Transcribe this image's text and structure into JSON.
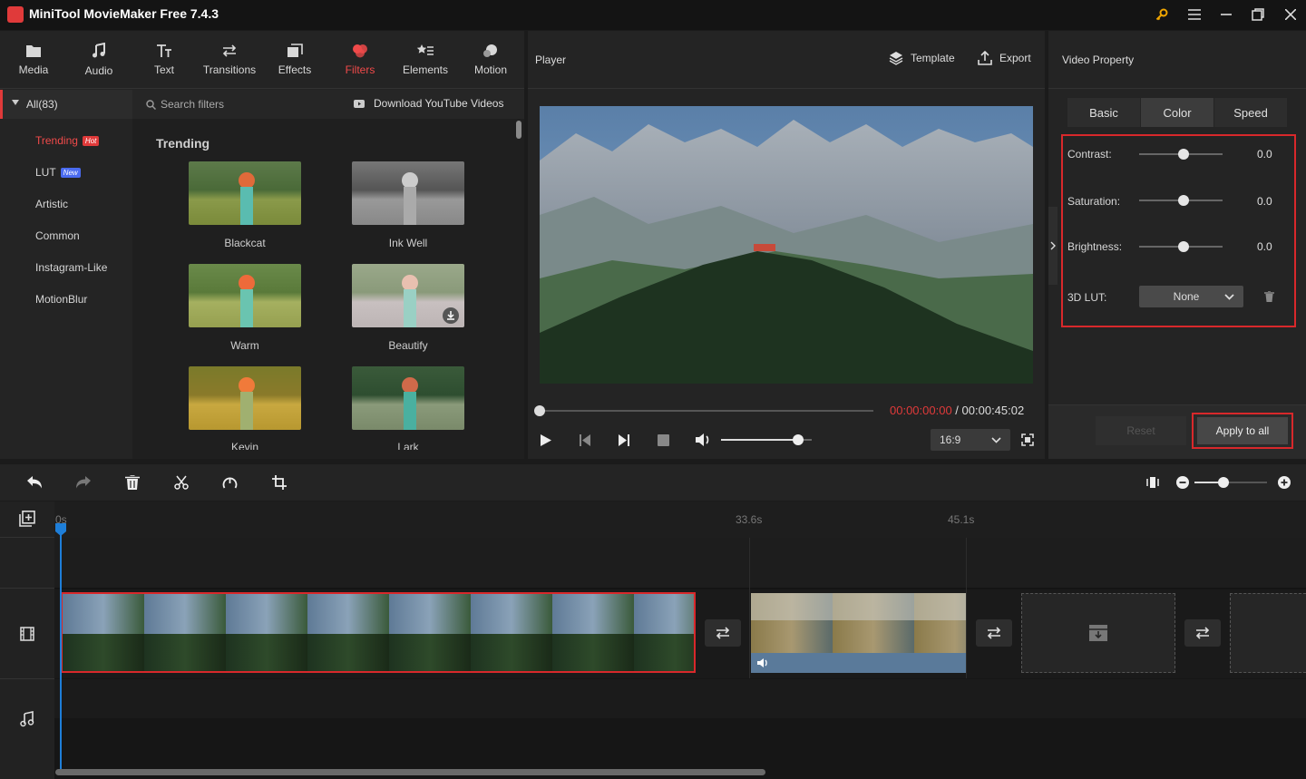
{
  "app": {
    "title": "MiniTool MovieMaker Free 7.4.3"
  },
  "toolbar": {
    "items": [
      {
        "label": "Media",
        "icon": "folder-icon"
      },
      {
        "label": "Audio",
        "icon": "music-note-icon"
      },
      {
        "label": "Text",
        "icon": "text-icon"
      },
      {
        "label": "Transitions",
        "icon": "transition-arrows-icon"
      },
      {
        "label": "Effects",
        "icon": "effects-icon"
      },
      {
        "label": "Filters",
        "icon": "filters-icon",
        "active": true
      },
      {
        "label": "Elements",
        "icon": "elements-icon"
      },
      {
        "label": "Motion",
        "icon": "motion-icon"
      }
    ]
  },
  "sidebar": {
    "all_label": "All(83)",
    "categories": [
      {
        "label": "Trending",
        "badge": "Hot"
      },
      {
        "label": "LUT",
        "badge": "New"
      },
      {
        "label": "Artistic"
      },
      {
        "label": "Common"
      },
      {
        "label": "Instagram-Like"
      },
      {
        "label": "MotionBlur"
      }
    ]
  },
  "filters": {
    "search_placeholder": "Search filters",
    "download_label": "Download YouTube Videos",
    "section_title": "Trending",
    "items": [
      {
        "label": "Blackcat"
      },
      {
        "label": "Ink Well"
      },
      {
        "label": "Warm"
      },
      {
        "label": "Beautify"
      },
      {
        "label": "Kevin"
      },
      {
        "label": "Lark"
      }
    ]
  },
  "player": {
    "title": "Player",
    "template_label": "Template",
    "export_label": "Export",
    "current_time": "00:00:00:00",
    "separator": " / ",
    "total_time": "00:00:45:02",
    "aspect_ratio": "16:9",
    "volume_level": 0.85
  },
  "property": {
    "title": "Video Property",
    "tabs": [
      "Basic",
      "Color",
      "Speed"
    ],
    "active_tab": "Color",
    "contrast_label": "Contrast:",
    "contrast_value": "0.0",
    "saturation_label": "Saturation:",
    "saturation_value": "0.0",
    "brightness_label": "Brightness:",
    "brightness_value": "0.0",
    "lut_label": "3D LUT:",
    "lut_value": "None",
    "reset_label": "Reset",
    "apply_label": "Apply to all"
  },
  "timeline": {
    "markers": [
      "0s",
      "33.6s",
      "45.1s"
    ],
    "zoom_level": 0.4
  },
  "colors": {
    "accent": "#e03a3a",
    "highlight_border": "#d8282b",
    "playhead": "#1e7ed8"
  }
}
